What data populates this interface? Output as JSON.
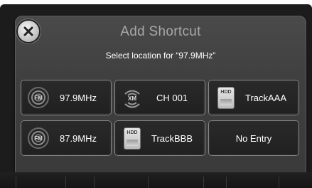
{
  "dialog": {
    "title": "Add Shortcut",
    "subtitle": "Select location for  “97.9MHz”",
    "close_icon": "close-icon"
  },
  "presets": [
    {
      "label": "97.9MHz",
      "icon": "fm-radio-icon"
    },
    {
      "label": "CH 001",
      "icon": "xm-radio-icon"
    },
    {
      "label": "TrackAAA",
      "icon": "hdd-icon",
      "icon_text": "HDD"
    },
    {
      "label": "87.9MHz",
      "icon": "fm-radio-icon"
    },
    {
      "label": "TrackBBB",
      "icon": "hdd-icon",
      "icon_text": "HDD"
    },
    {
      "label": "No Entry",
      "icon": ""
    }
  ],
  "colors": {
    "background": "#1c1c1c",
    "dialog": "#3f3f3f",
    "title_text": "#a8a8a8",
    "label_text": "#ffffff"
  }
}
